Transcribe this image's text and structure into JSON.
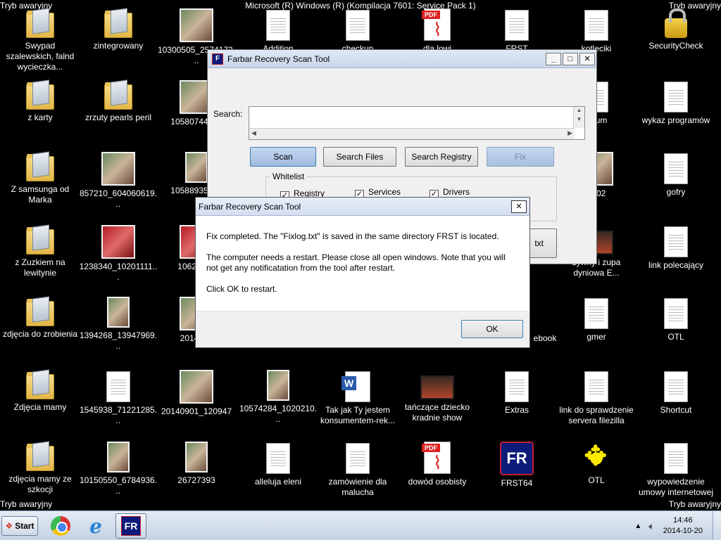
{
  "desktop": {
    "mode_label": "Tryb awaryjny",
    "os_title": "Microsoft (R) Windows (R) (Kompilacja 7601: Service Pack 1)",
    "icons": [
      {
        "label": "Swypad szalewskich, falnd wycieczka..."
      },
      {
        "label": "z karty"
      },
      {
        "label": "Z samsunga od Marka"
      },
      {
        "label": "z Zuzkiem na lewitynie"
      },
      {
        "label": "zdjęcia do zrobienia"
      },
      {
        "label": "Zdjęcia mamy"
      },
      {
        "label": "zdjęcia mamy ze szkocji"
      },
      {
        "label": "zintegrowany"
      },
      {
        "label": "zrzuty pearls peril"
      },
      {
        "label": "857210_604060619..."
      },
      {
        "label": "1238340_10201111..."
      },
      {
        "label": "1394268_13947969..."
      },
      {
        "label": "1545938_71221285..."
      },
      {
        "label": "10150550_6784936..."
      },
      {
        "label": "10300505_2574173..."
      },
      {
        "label": "10580744_88"
      },
      {
        "label": "10588935_10"
      },
      {
        "label": "10628151"
      },
      {
        "label": "2014080"
      },
      {
        "label": "20140901_120947"
      },
      {
        "label": "26727393"
      },
      {
        "label": "Addition"
      },
      {
        "label": "10574284_1020210..."
      },
      {
        "label": "alleluja eleni"
      },
      {
        "label": "checkup"
      },
      {
        "label": "Tak jak Ty jestem konsumentem-rek..."
      },
      {
        "label": "zamówienie dla malucha"
      },
      {
        "label": "dla lowi"
      },
      {
        "label": "tańczące dziecko kradnie show"
      },
      {
        "label": "dowód osobisty"
      },
      {
        "label": "FRST"
      },
      {
        "label": "Extras"
      },
      {
        "label": "FRST64"
      },
      {
        "label": "kotleciki"
      },
      {
        "label": "forum"
      },
      {
        "label": "2602"
      },
      {
        "label": "zywny i zupa dyniowa E..."
      },
      {
        "label": "ebook"
      },
      {
        "label": "gmer"
      },
      {
        "label": "link do sprawdzenie servera filezilla"
      },
      {
        "label": "OTL"
      },
      {
        "label": "SecurityCheck"
      },
      {
        "label": "wykaz programów"
      },
      {
        "label": "gofry"
      },
      {
        "label": "link polecający"
      },
      {
        "label": "OTL"
      },
      {
        "label": "Shortcut"
      },
      {
        "label": "wypowiedzenie umowy internetowej"
      }
    ]
  },
  "frst_window": {
    "title": "Farbar Recovery Scan Tool",
    "search_label": "Search:",
    "search_value": "",
    "buttons": {
      "scan": "Scan",
      "search_files": "Search Files",
      "search_registry": "Search Registry",
      "fix": "Fix"
    },
    "whitelist": {
      "label": "Whitelist",
      "registry": "Registry",
      "services": "Services",
      "drivers": "Drivers"
    },
    "partial_button": "txt"
  },
  "dialog": {
    "title": "Farbar Recovery Scan Tool",
    "line1": "Fix completed. The \"Fixlog.txt\" is saved in the same directory FRST is located.",
    "line2": "The computer needs a restart. Please close all open windows. Note that you will not get any notificatation from the tool after restart.",
    "line3": "Click OK to restart.",
    "ok": "OK"
  },
  "taskbar": {
    "start": "Start",
    "time": "14:46",
    "date": "2014-10-20"
  }
}
